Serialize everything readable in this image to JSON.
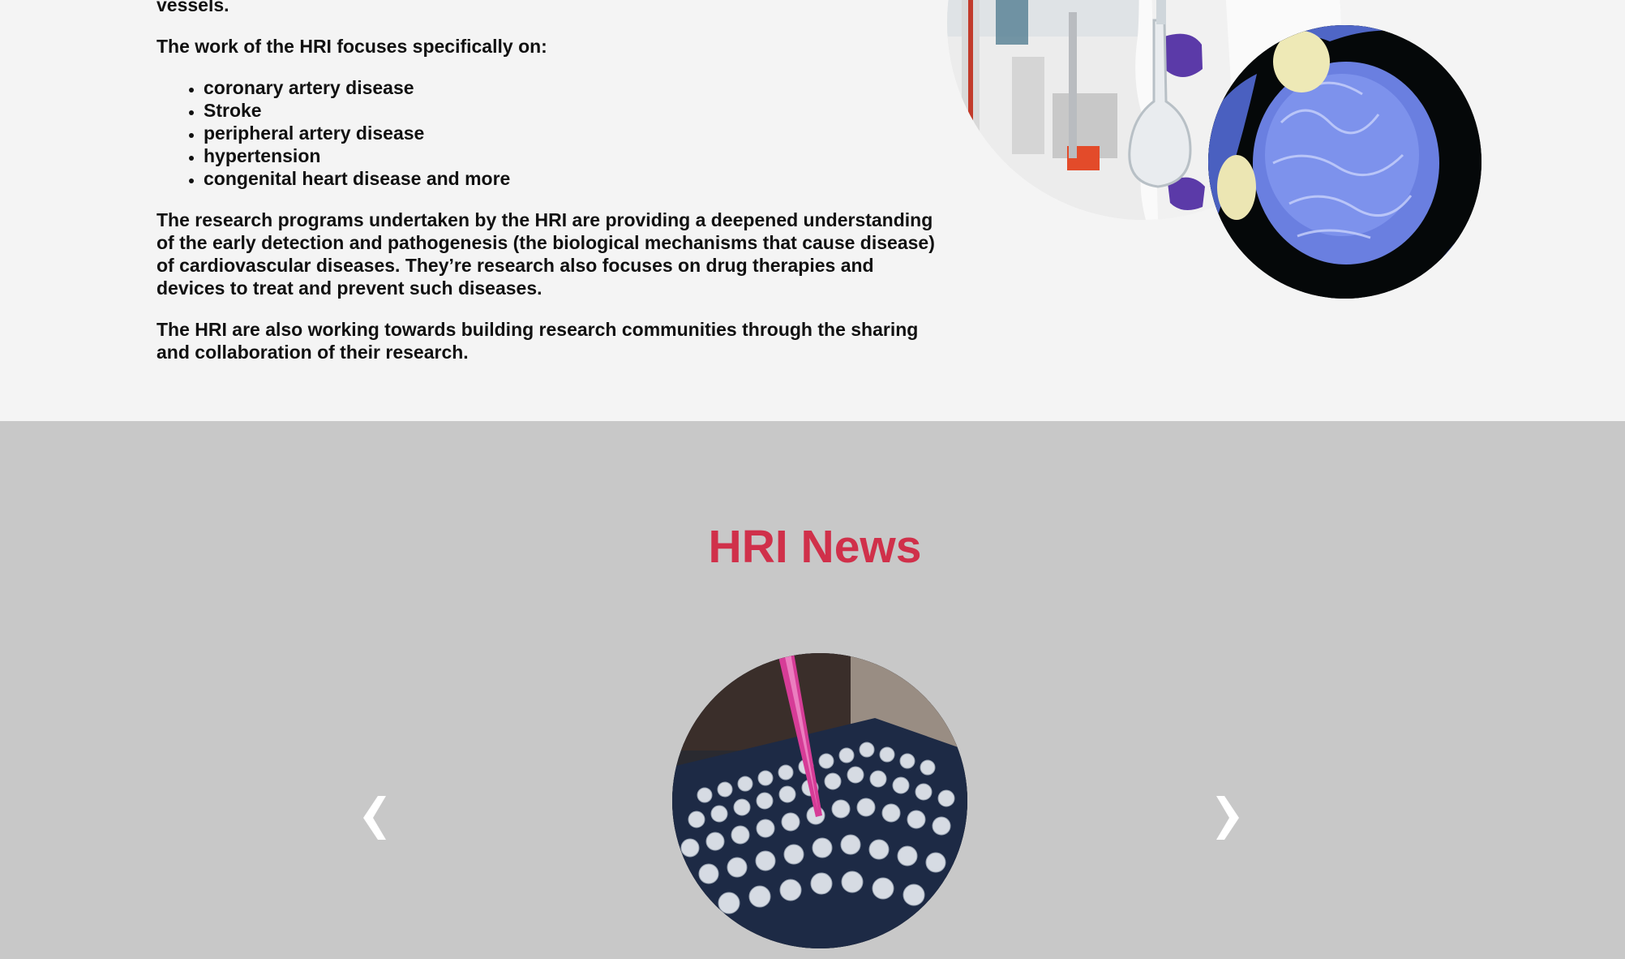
{
  "about": {
    "intro_tail": "vessels.",
    "focus_intro": "The work of the HRI focuses specifically on:",
    "focus_items": [
      "coronary artery disease",
      "Stroke",
      "peripheral artery disease",
      "hypertension",
      "congenital heart disease and more"
    ],
    "paragraph_research": "The research programs undertaken by the HRI are providing a deepened understanding of the early detection and pathogenesis (the biological mechanisms that cause disease) of cardiovascular diseases. They’re research also focuses on drug therapies and devices to treat and prevent such diseases.",
    "paragraph_community": "The HRI are also working towards building research communities through the sharing and collaboration of their research."
  },
  "news": {
    "title": "HRI News",
    "prev_icon": "chevron-left-icon",
    "next_icon": "chevron-right-icon"
  },
  "colors": {
    "accent": "#d0304a",
    "top_background": "#f4f4f4",
    "news_background": "#c8c8c8"
  }
}
